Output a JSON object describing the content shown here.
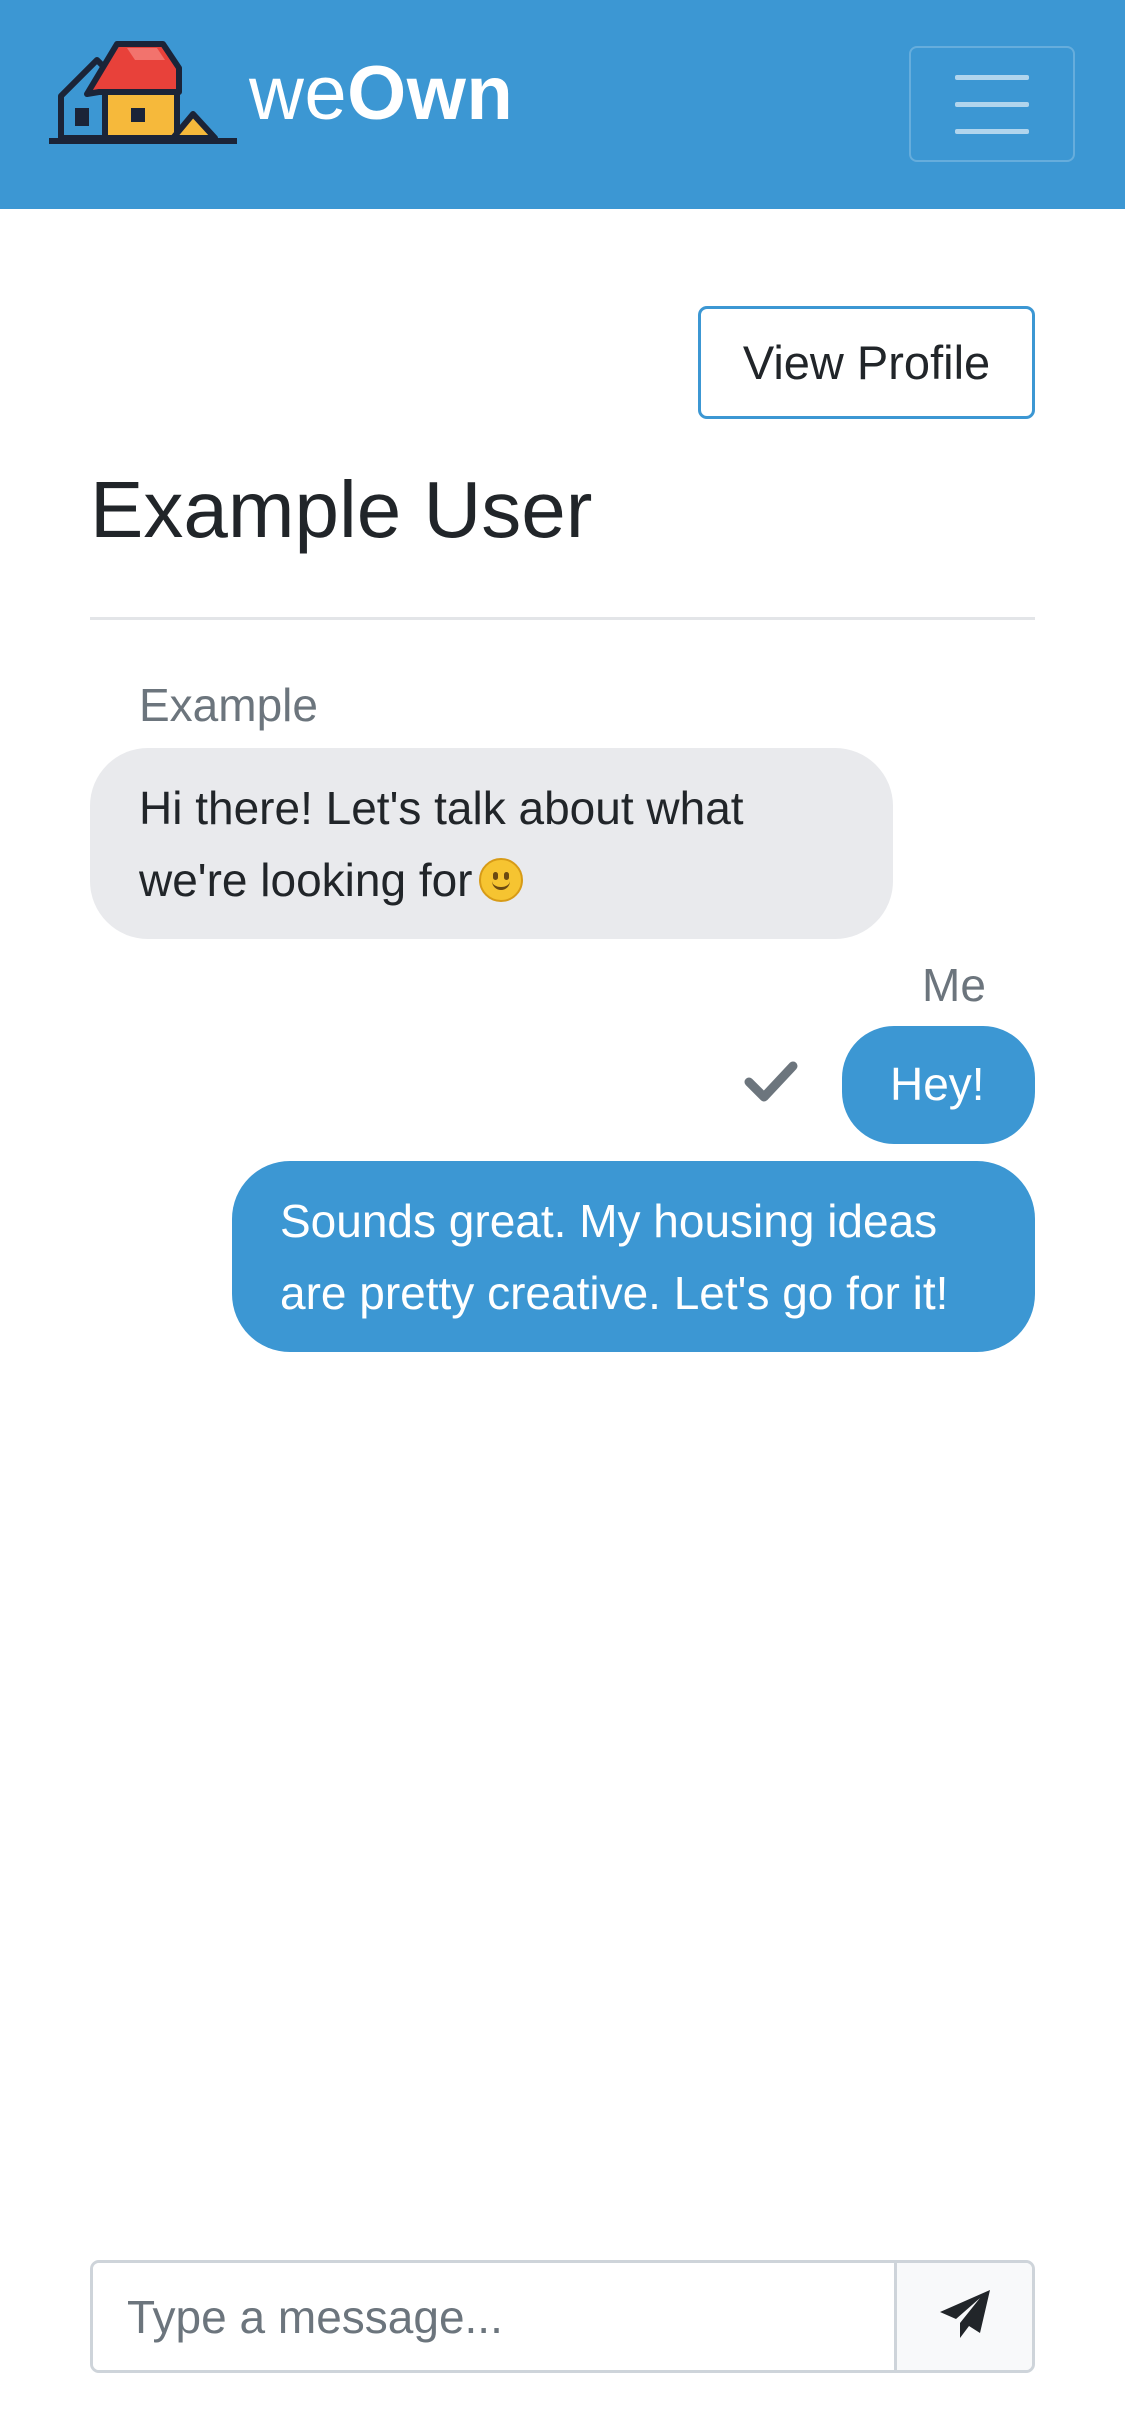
{
  "header": {
    "brand_prefix": "we",
    "brand_suffix": "Own",
    "menu_icon": "hamburger-menu-icon",
    "background_color": "#3c97d3"
  },
  "conversation": {
    "view_profile_label": "View Profile",
    "title": "Example User"
  },
  "messages": [
    {
      "sender": "Example",
      "text": "Hi there! Let's talk about what we're looking for",
      "emoji": "slightly-smiling-face-icon",
      "direction": "incoming"
    },
    {
      "sender": "Me",
      "text": "Hey!",
      "direction": "outgoing",
      "status_icon": "checkmark-icon"
    },
    {
      "text": "Sounds great. My housing ideas are pretty creative. Let's go for it!",
      "direction": "outgoing"
    }
  ],
  "composer": {
    "placeholder": "Type a message...",
    "send_icon": "paper-plane-icon"
  },
  "colors": {
    "accent": "#3c97d3",
    "incoming_bubble": "#e9eaed",
    "muted_text": "#6c757d"
  }
}
